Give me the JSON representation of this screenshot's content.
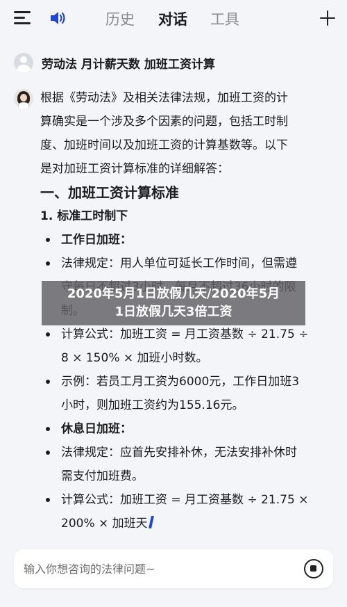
{
  "header": {
    "tabs": [
      {
        "label": "历史",
        "active": false
      },
      {
        "label": "对话",
        "active": true
      },
      {
        "label": "工具",
        "active": false
      }
    ],
    "icons": [
      "menu-icon",
      "speaker-icon",
      "plus-icon"
    ]
  },
  "chat": {
    "user_message": "劳动法 月计薪天数 加班工资计算",
    "answer": {
      "intro": [
        "根据《劳动法》及相关法律法规，加班工资的计",
        "算确实是一个涉及多个因素的问题，包括工时制",
        "度、加班时间以及加班工资的计算基数等。以下",
        "是对加班工资计算标准的详细解答："
      ],
      "section_title": "一、加班工资计算标准",
      "subsection_title": "1. 标准工时制下",
      "items": [
        {
          "text": "工作日加班：",
          "bold": true
        },
        {
          "lines": [
            "法律规定：用人单位可延长工作时间，但需遵",
            "守每日不超过3小时，每月不超过36小时的限",
            "制。"
          ]
        },
        {
          "lines": [
            "计算公式：加班工资 = 月工资基数 ÷ 21.75 ÷",
            "8 × 150% × 加班小时数。"
          ]
        },
        {
          "lines": [
            "示例：若员工月工资为6000元，工作日加班3",
            "小时，则加班工资约为155.16元。"
          ]
        },
        {
          "text": "休息日加班：",
          "bold": true
        },
        {
          "lines": [
            "法律规定：应首先安排补休，无法安排补休时",
            "需支付加班费。"
          ]
        },
        {
          "lines": [
            "计算公式：加班工资 = 月工资基数 ÷ 21.75 ×",
            "200% × 加班天"
          ]
        }
      ]
    }
  },
  "watermark": {
    "line1": "2020年5月1日放假几天/2020年5月",
    "line2": "1日放假几天3倍工资"
  },
  "input": {
    "placeholder": "输入你想咨询的法律问题~",
    "value": ""
  },
  "colors": {
    "background": "#f4f5f8",
    "accent": "#1e48d6",
    "text": "#1c1c1e",
    "muted": "#8a8a8e"
  }
}
